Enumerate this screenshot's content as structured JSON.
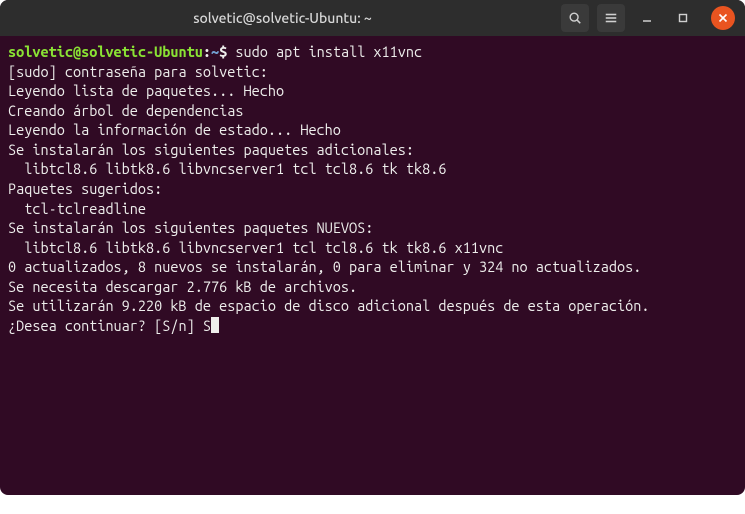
{
  "window": {
    "title": "solvetic@solvetic-Ubuntu: ~"
  },
  "prompt": {
    "user_host": "solvetic@solvetic-Ubuntu",
    "separator": ":",
    "path": "~",
    "symbol": "$",
    "command": "sudo apt install x11vnc"
  },
  "output": {
    "l0": "[sudo] contraseña para solvetic:",
    "l1": "Leyendo lista de paquetes... Hecho",
    "l2": "Creando árbol de dependencias",
    "l3": "Leyendo la información de estado... Hecho",
    "l4": "Se instalarán los siguientes paquetes adicionales:",
    "l5": "  libtcl8.6 libtk8.6 libvncserver1 tcl tcl8.6 tk tk8.6",
    "l6": "Paquetes sugeridos:",
    "l7": "  tcl-tclreadline",
    "l8": "Se instalarán los siguientes paquetes NUEVOS:",
    "l9": "  libtcl8.6 libtk8.6 libvncserver1 tcl tcl8.6 tk tk8.6 x11vnc",
    "l10": "0 actualizados, 8 nuevos se instalarán, 0 para eliminar y 324 no actualizados.",
    "l11": "Se necesita descargar 2.776 kB de archivos.",
    "l12": "Se utilizarán 9.220 kB de espacio de disco adicional después de esta operación.",
    "l13": "¿Desea continuar? [S/n] S"
  }
}
